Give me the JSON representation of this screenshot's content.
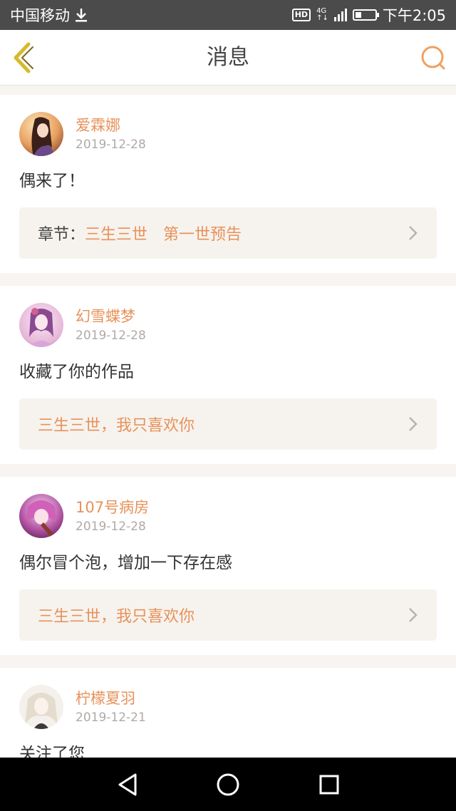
{
  "status_bar": {
    "carrier": "中国移动",
    "hd": "HD",
    "network": "4G",
    "network_sub": "↑↓",
    "time": "下午2:05",
    "battery_level": 0.3
  },
  "header": {
    "title": "消息"
  },
  "colors": {
    "accent": "#e8915a",
    "back_icon": "#d8b92a",
    "search_icon": "#f0a060"
  },
  "messages": [
    {
      "username": "爱霖娜",
      "date": "2019-12-28",
      "text": "偶来了！",
      "ref_label": "章节：",
      "ref_text": "三生三世　第一世预告"
    },
    {
      "username": "幻雪蝶梦",
      "date": "2019-12-28",
      "text": "收藏了你的作品",
      "ref_label": "",
      "ref_text": "三生三世，我只喜欢你"
    },
    {
      "username": "107号病房",
      "date": "2019-12-28",
      "text": "偶尔冒个泡，增加一下存在感",
      "ref_label": "",
      "ref_text": "三生三世，我只喜欢你"
    },
    {
      "username": "柠檬夏羽",
      "date": "2019-12-21",
      "text": "关注了您"
    }
  ],
  "icons": {
    "download": "download-icon",
    "back": "chevron-left-icon",
    "search": "search-icon",
    "chevron": "chevron-right-icon",
    "nav_back": "triangle-back-icon",
    "nav_home": "circle-home-icon",
    "nav_recent": "square-recent-icon"
  }
}
